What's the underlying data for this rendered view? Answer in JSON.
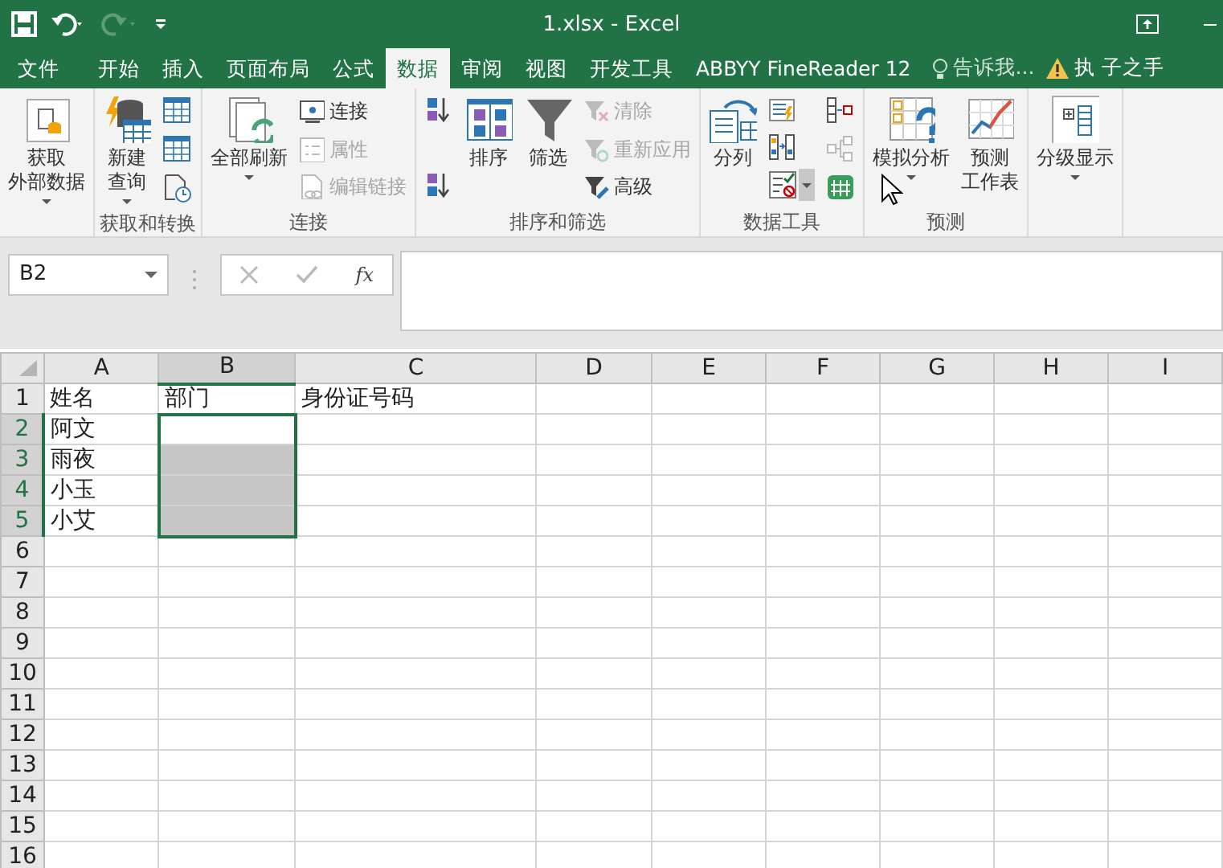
{
  "title_bar": {
    "title": "1.xlsx - Excel",
    "redo_disabled": true
  },
  "tabs": [
    {
      "label": "文件",
      "selected": false
    },
    {
      "label": "开始",
      "selected": false
    },
    {
      "label": "插入",
      "selected": false
    },
    {
      "label": "页面布局",
      "selected": false
    },
    {
      "label": "公式",
      "selected": false
    },
    {
      "label": "数据",
      "selected": true
    },
    {
      "label": "审阅",
      "selected": false
    },
    {
      "label": "视图",
      "selected": false
    },
    {
      "label": "开发工具",
      "selected": false
    },
    {
      "label": "ABBYY FineReader 12",
      "selected": false
    }
  ],
  "tell_me": {
    "placeholder": "告诉我..."
  },
  "user": {
    "name": "执 子之手"
  },
  "ribbon": {
    "groups": [
      {
        "columns": [
          [
            {
              "kind": "large",
              "lines": [
                "获取",
                "外部数据"
              ],
              "dropdown": true
            }
          ]
        ]
      },
      {
        "label": "获取和转换",
        "columns": [
          [
            {
              "kind": "large",
              "lines": [
                "新建",
                "查询"
              ],
              "dropdown": true
            }
          ],
          [
            {
              "kind": "icon"
            },
            {
              "kind": "icon"
            },
            {
              "kind": "icon"
            }
          ]
        ]
      },
      {
        "label": "连接",
        "columns": [
          [
            {
              "kind": "large",
              "label": "全部刷新",
              "dropdown": true
            }
          ],
          [
            {
              "kind": "small",
              "label": "连接",
              "disabled": false
            },
            {
              "kind": "small",
              "label": "属性",
              "disabled": true
            },
            {
              "kind": "small",
              "label": "编辑链接",
              "disabled": true
            }
          ]
        ]
      },
      {
        "label": "排序和筛选",
        "columns": [
          [
            {
              "kind": "icon"
            },
            {
              "kind": "icon"
            }
          ],
          [
            {
              "kind": "large",
              "label": "排序"
            }
          ],
          [
            {
              "kind": "large",
              "label": "筛选"
            }
          ],
          [
            {
              "kind": "small",
              "label": "清除",
              "disabled": true
            },
            {
              "kind": "small",
              "label": "重新应用",
              "disabled": true
            },
            {
              "kind": "small",
              "label": "高级",
              "disabled": false
            }
          ]
        ]
      },
      {
        "label": "数据工具",
        "columns": [
          [
            {
              "kind": "large",
              "label": "分列"
            }
          ],
          [
            {
              "kind": "icon"
            },
            {
              "kind": "icon"
            },
            {
              "kind": "icon",
              "dropdown": true
            }
          ],
          [
            {
              "kind": "icon"
            },
            {
              "kind": "icon",
              "disabled": true
            },
            {
              "kind": "icon"
            }
          ]
        ]
      },
      {
        "label": "预测",
        "columns": [
          [
            {
              "kind": "large",
              "label": "模拟分析",
              "dropdown": true
            }
          ],
          [
            {
              "kind": "large",
              "lines": [
                "预测",
                "工作表"
              ]
            }
          ]
        ]
      },
      {
        "columns": [
          [
            {
              "kind": "large",
              "label": "分级显示",
              "dropdown": true
            }
          ]
        ]
      }
    ]
  },
  "formula_bar": {
    "name_box": "B2",
    "function_label": "fx"
  },
  "sheet": {
    "columns": [
      {
        "label": "A",
        "selected": false
      },
      {
        "label": "B",
        "selected": true
      },
      {
        "label": "C",
        "selected": false
      },
      {
        "label": "D",
        "selected": false
      },
      {
        "label": "E",
        "selected": false
      },
      {
        "label": "F",
        "selected": false
      },
      {
        "label": "G",
        "selected": false
      },
      {
        "label": "H",
        "selected": false
      },
      {
        "label": "I",
        "selected": false
      }
    ],
    "rows": [
      {
        "header": "1",
        "selected": false,
        "cells": [
          "姓名",
          "部门",
          "身份证号码"
        ]
      },
      {
        "header": "2",
        "selected": true,
        "cells": [
          "阿文"
        ]
      },
      {
        "header": "3",
        "selected": true,
        "cells": [
          "雨夜"
        ]
      },
      {
        "header": "4",
        "selected": true,
        "cells": [
          "小玉"
        ]
      },
      {
        "header": "5",
        "selected": true,
        "cells": [
          "小艾"
        ]
      },
      {
        "header": "6",
        "selected": false,
        "cells": []
      },
      {
        "header": "7",
        "selected": false,
        "cells": []
      },
      {
        "header": "8",
        "selected": false,
        "cells": []
      },
      {
        "header": "9",
        "selected": false,
        "cells": []
      },
      {
        "header": "10",
        "selected": false,
        "cells": []
      },
      {
        "header": "11",
        "selected": false,
        "cells": []
      },
      {
        "header": "12",
        "selected": false,
        "cells": []
      },
      {
        "header": "13",
        "selected": false,
        "cells": []
      },
      {
        "header": "14",
        "selected": false,
        "cells": []
      },
      {
        "header": "15",
        "selected": false,
        "cells": []
      },
      {
        "header": "16",
        "selected": false,
        "cells": []
      }
    ]
  }
}
